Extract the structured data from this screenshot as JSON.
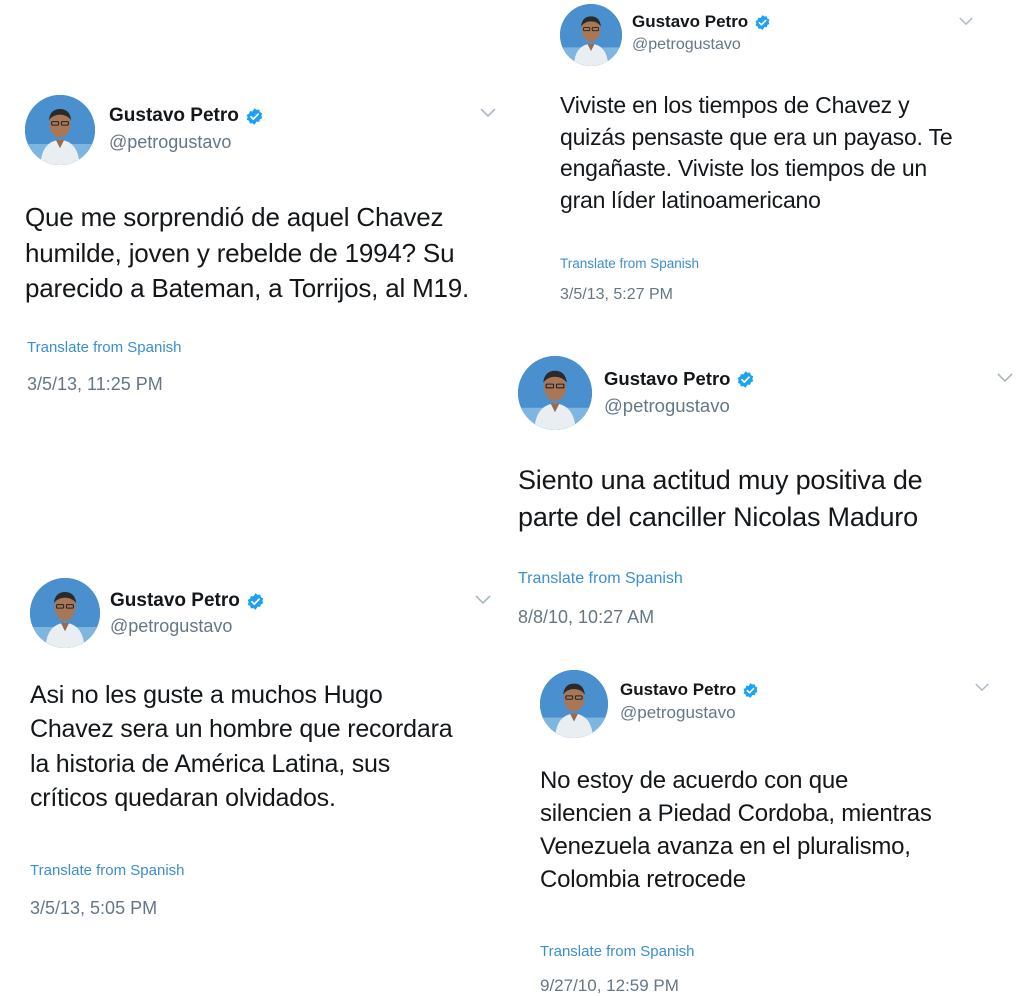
{
  "colors": {
    "name": "#14171a",
    "handle": "#657786",
    "translate_link": "#3a8fcf",
    "verified_badge": "#1da1f2",
    "chevron": "#aab8c2",
    "avatar_background": "#3b83c4"
  },
  "icons": {
    "avatar": "profile-photo",
    "verified": "verified-badge-icon",
    "menu": "chevron-down-icon"
  },
  "tweets": [
    {
      "name": "Gustavo Petro",
      "handle": "@petrogustavo",
      "text": "Que me sorprendió de aquel Chavez\nhumilde, joven y rebelde de 1994? Su\nparecido a Bateman, a Torrijos, al M19.",
      "translate": "Translate from Spanish",
      "time": "3/5/13, 11:25 PM"
    },
    {
      "name": "Gustavo Petro",
      "handle": "@petrogustavo",
      "text": "Viviste en los tiempos de Chavez y\nquizás pensaste que era un payaso. Te\nengañaste. Viviste los tiempos de un\ngran líder latinoamericano",
      "translate": "Translate from Spanish",
      "time": "3/5/13, 5:27 PM"
    },
    {
      "name": "Gustavo Petro",
      "handle": "@petrogustavo",
      "text": "Siento una actitud muy positiva de\nparte del canciller Nicolas Maduro",
      "translate": "Translate from Spanish",
      "time": "8/8/10, 10:27 AM"
    },
    {
      "name": "Gustavo Petro",
      "handle": "@petrogustavo",
      "text": "Asi no les guste a muchos Hugo\nChavez sera un hombre que recordara\nla historia de América Latina, sus\ncríticos quedaran olvidados.",
      "translate": "Translate from Spanish",
      "time": "3/5/13, 5:05 PM"
    },
    {
      "name": "Gustavo Petro",
      "handle": "@petrogustavo",
      "text": "No estoy de acuerdo con que\nsilencien a Piedad Cordoba, mientras\nVenezuela avanza en el pluralismo,\nColombia retrocede",
      "translate": "Translate from Spanish",
      "time": "9/27/10, 12:59 PM"
    }
  ]
}
